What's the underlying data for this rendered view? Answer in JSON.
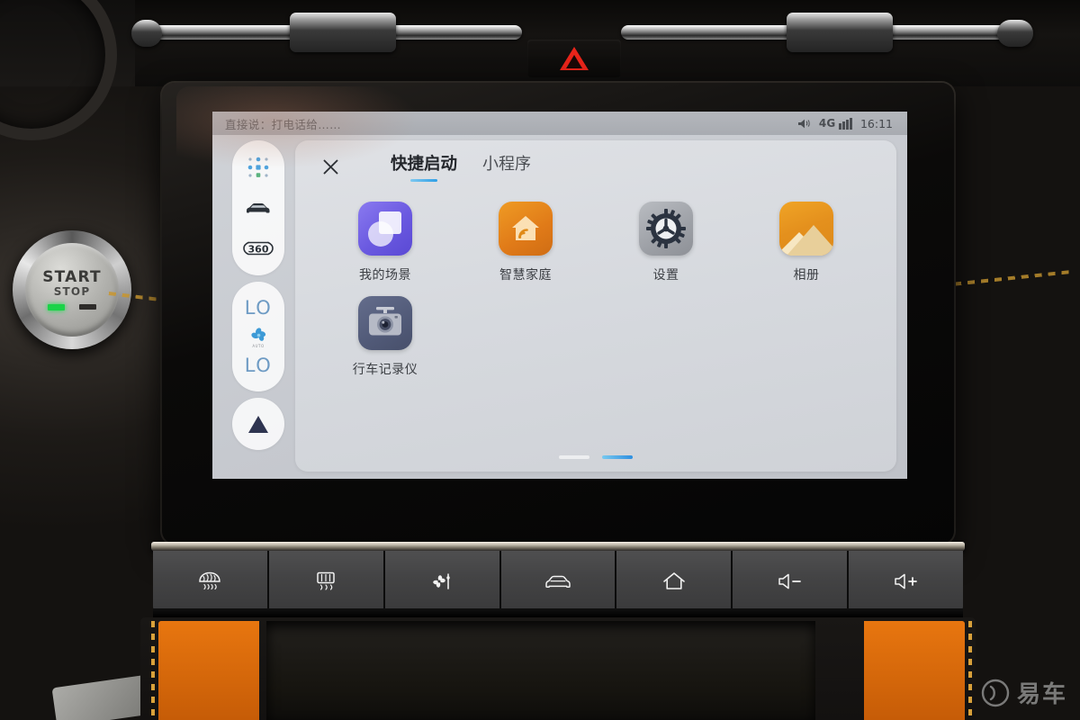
{
  "screen": {
    "status_bar": {
      "voice_hint": "直接说：打电话给……",
      "speaker_icon": "speaker-icon",
      "network": "4G",
      "signal_bars": 4,
      "clock": "16:11"
    },
    "left_rail": {
      "items": [
        {
          "name": "apps-grid-icon",
          "label": ""
        },
        {
          "name": "car-icon",
          "label": ""
        },
        {
          "name": "camera-360-icon",
          "label": "360"
        },
        {
          "name": "temperature-left",
          "label": "LO"
        },
        {
          "name": "fan-icon",
          "label": ""
        },
        {
          "name": "temperature-right",
          "label": "LO"
        },
        {
          "name": "navigation-arrow-icon",
          "label": ""
        }
      ],
      "fan_sub_label": "AUTO"
    },
    "card": {
      "close_label": "✕",
      "tabs": [
        {
          "label": "快捷启动",
          "active": true
        },
        {
          "label": "小程序",
          "active": false
        }
      ],
      "apps": [
        {
          "label": "我的场景",
          "icon": "scene-icon",
          "color": "#6a59e0"
        },
        {
          "label": "智慧家庭",
          "icon": "smart-home-icon",
          "color": "#e07a18"
        },
        {
          "label": "设置",
          "icon": "settings-gear-icon",
          "color": "#9da0a6"
        },
        {
          "label": "相册",
          "icon": "album-icon",
          "color": "#e4901d"
        },
        {
          "label": "行车记录仪",
          "icon": "dashcam-icon",
          "color": "#515a78"
        }
      ],
      "page_dots": [
        {
          "active": false
        },
        {
          "active": true
        }
      ]
    }
  },
  "hardware": {
    "start_stop": {
      "start": "START",
      "stop": "STOP"
    },
    "hazard_button": "hazard-triangle-icon",
    "buttons": [
      {
        "name": "front-defrost-button",
        "icon": "front-defrost-icon"
      },
      {
        "name": "rear-defrost-button",
        "icon": "rear-defrost-icon"
      },
      {
        "name": "fan-ac-button",
        "icon": "fan-ac-icon"
      },
      {
        "name": "car-view-button",
        "icon": "car-icon"
      },
      {
        "name": "home-button",
        "icon": "home-icon"
      },
      {
        "name": "volume-down-button",
        "icon": "volume-down-icon"
      },
      {
        "name": "volume-up-button",
        "icon": "volume-up-icon"
      }
    ]
  },
  "watermark": {
    "text": "易车"
  }
}
